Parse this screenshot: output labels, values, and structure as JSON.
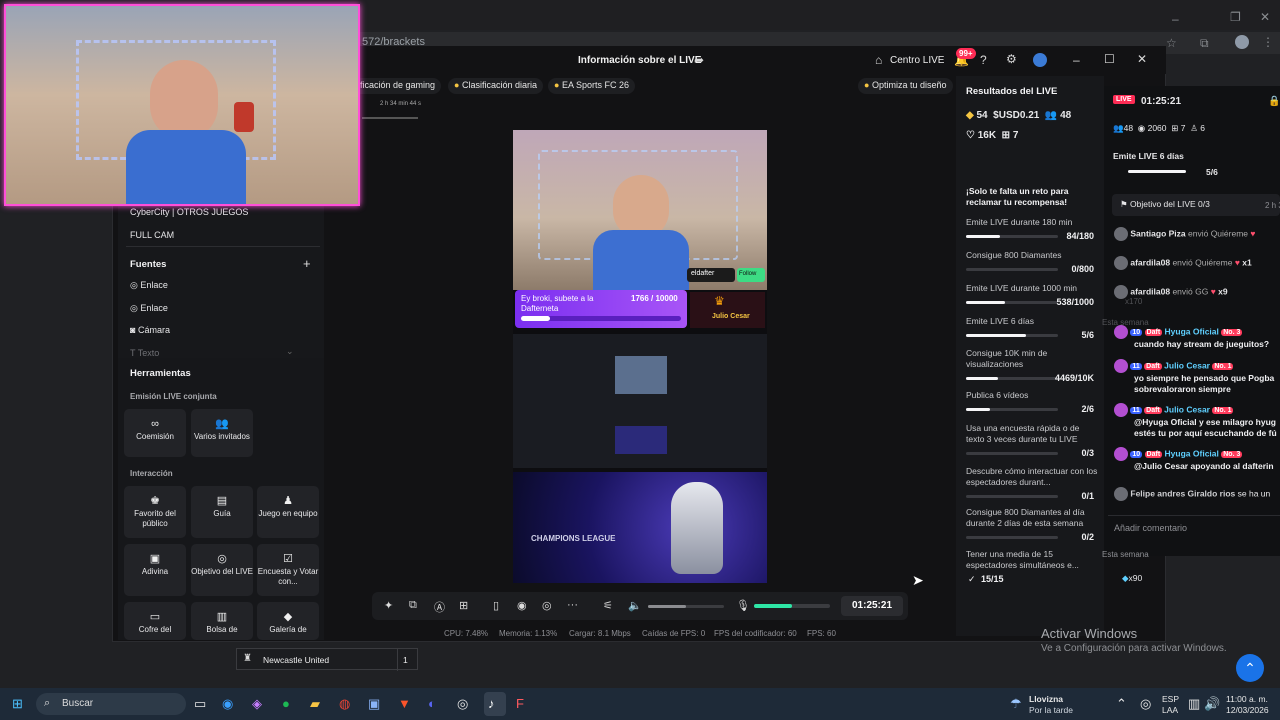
{
  "browser": {
    "url_fragment": "572/brackets"
  },
  "studio_header": {
    "title": "Información sobre el LIVE",
    "centro_live": "Centro LIVE",
    "notif_badge": "99+",
    "chips": [
      "ificación de gaming",
      "Clasificación diaria",
      "EA Sports FC 26"
    ],
    "optimize": "Optimiza tu diseño",
    "mini_timer": "2 h 34 min 44 s"
  },
  "left_panel": {
    "scenes": [
      "CyberCity | OTROS JUEGOS",
      "FULL CAM"
    ],
    "sources_title": "Fuentes",
    "sources": [
      "Enlace",
      "Enlace",
      "Cámara",
      "Texto"
    ],
    "tools_title": "Herramientas",
    "joint_title": "Emisión LIVE conjunta",
    "joint_tools": [
      "Coemisión",
      "Varios invitados"
    ],
    "interaction_title": "Interacción",
    "interaction_tools": [
      "Favorito del público",
      "Guía",
      "Juego en equipo",
      "Adivina",
      "Objetivo del LIVE",
      "Encuesta y Votar con...",
      "Cofre del",
      "Bolsa de",
      "Galería de"
    ]
  },
  "preview": {
    "goal_text": "Ey broki, subete a la Dafterneta",
    "goal_count": "1766 / 10000",
    "cam_name": "eldafter",
    "follow": "Follow",
    "julio": "Julio Cesar",
    "ucl": "CHAMPIONS LEAGUE"
  },
  "toolbar": {
    "timer": "01:25:21",
    "volume_level": 0.5,
    "mic_level": 0.5
  },
  "stats": {
    "cpu": "CPU: 7.48%",
    "memoria": "Memoria: 1.13%",
    "cargar": "Cargar: 8.1 Mbps",
    "caidas": "Caídas de FPS: 0",
    "fps_cod": "FPS del codificador: 60",
    "fps": "FPS: 60"
  },
  "results": {
    "title": "Resultados del LIVE",
    "diamonds": "54",
    "usd": "USD0.21",
    "viewers": "48",
    "likes": "16K",
    "gifts": "7",
    "reward_msg": "¡Solo te falta un reto para reclamar tu recompensa!",
    "tasks": [
      {
        "label": "Emite LIVE durante 180 min",
        "value": "84/180",
        "progress": 0.47
      },
      {
        "label": "Consigue 800 Diamantes",
        "value": "0/800",
        "progress": 0.0
      },
      {
        "label": "Emite LIVE durante 1000 min",
        "value": "538/1000",
        "progress": 0.54
      },
      {
        "label": "Emite LIVE 6 días",
        "value": "5/6",
        "progress": 0.83
      },
      {
        "label": "Consigue 10K min de visualizaciones",
        "value": "4469/10K",
        "progress": 0.45
      },
      {
        "label": "Publica 6 vídeos",
        "value": "2/6",
        "progress": 0.33
      },
      {
        "label": "Usa una encuesta rápida o de texto 3 veces durante tu LIVE",
        "value": "0/3",
        "progress": 0.0
      },
      {
        "label": "Descubre cómo interactuar con los espectadores durant...",
        "value": "0/1",
        "progress": 0.0
      },
      {
        "label": "Consigue 800 Diamantes al día durante 2 días de esta semana",
        "value": "0/2",
        "progress": 0.0
      },
      {
        "label": "Tener una media de 15 espectadores simultáneos e...",
        "value": "15/15",
        "progress": 1.0
      }
    ]
  },
  "overlay": {
    "live_tag": "LIVE",
    "timer": "01:25:21",
    "viewers": "48",
    "views": "2060",
    "gifts": "7",
    "followers": "6",
    "streak_label": "Emite LIVE 6 días",
    "streak_value": "5/6",
    "objective": "Objetivo del LIVE 0/3",
    "objective_side": "2 h 3",
    "week": "Esta semana",
    "gifts_feed": [
      {
        "user": "Santiago Piza",
        "msg": "envió Quiéreme",
        "count": ""
      },
      {
        "user": "afardila08",
        "msg": "envió Quiéreme",
        "count": "x1"
      },
      {
        "user": "afardila08",
        "msg": "envió GG",
        "count": "x9"
      }
    ],
    "faded_count": "x170",
    "chat": [
      {
        "lvl": "10",
        "tag": "Daft",
        "user": "Hyuga Oficial",
        "rank": "No. 3",
        "msg": "cuando hay stream de jueguitos?"
      },
      {
        "lvl": "11",
        "tag": "Daft",
        "user": "Julio Cesar",
        "rank": "No. 1",
        "msg": "yo siempre he pensado que Pogba sobrevaloraron siempre"
      },
      {
        "lvl": "11",
        "tag": "Daft",
        "user": "Julio Cesar",
        "rank": "No. 1",
        "msg": "@Hyuga Oficial y ese milagro hyug estés tu por aquí escuchando de fú"
      },
      {
        "lvl": "10",
        "tag": "Daft",
        "user": "Hyuga Oficial",
        "rank": "No. 3",
        "msg": "@Julio Cesar apoyando al dafterin"
      }
    ],
    "last_user": "Felipe andres Giraldo rios",
    "last_msg": "se ha un",
    "comment_placeholder": "Añadir comentario",
    "bottom_week": "Esta semana",
    "bottom_count": "x90"
  },
  "league": {
    "team": "Newcastle United",
    "score": "1"
  },
  "activate": {
    "line1": "Activar Windows",
    "line2": "Ve a Configuración para activar Windows."
  },
  "taskbar": {
    "search": "Buscar",
    "weather_title": "Llovizna",
    "weather_sub": "Por la tarde",
    "lang": "ESP",
    "lang_sub": "LAA",
    "time": "11:00 a. m.",
    "date": "12/03/2026"
  }
}
